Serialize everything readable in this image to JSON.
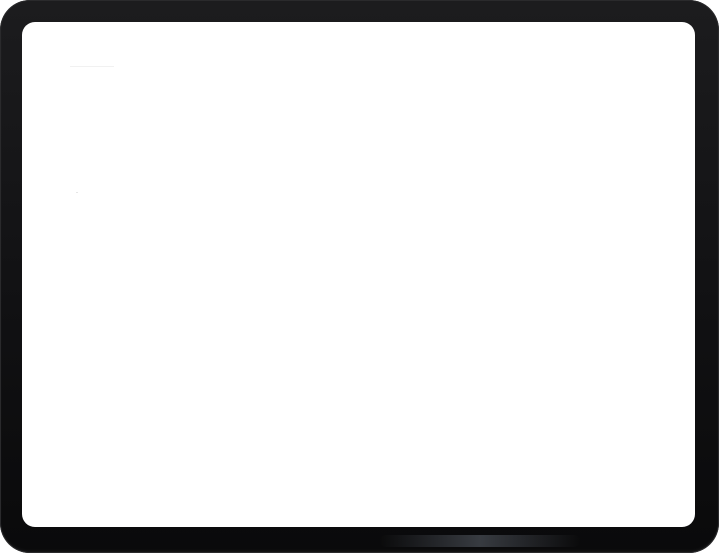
{
  "device": {
    "frame_color": "#111113",
    "screen_color": "#ffffff",
    "screen_state": "blank"
  }
}
